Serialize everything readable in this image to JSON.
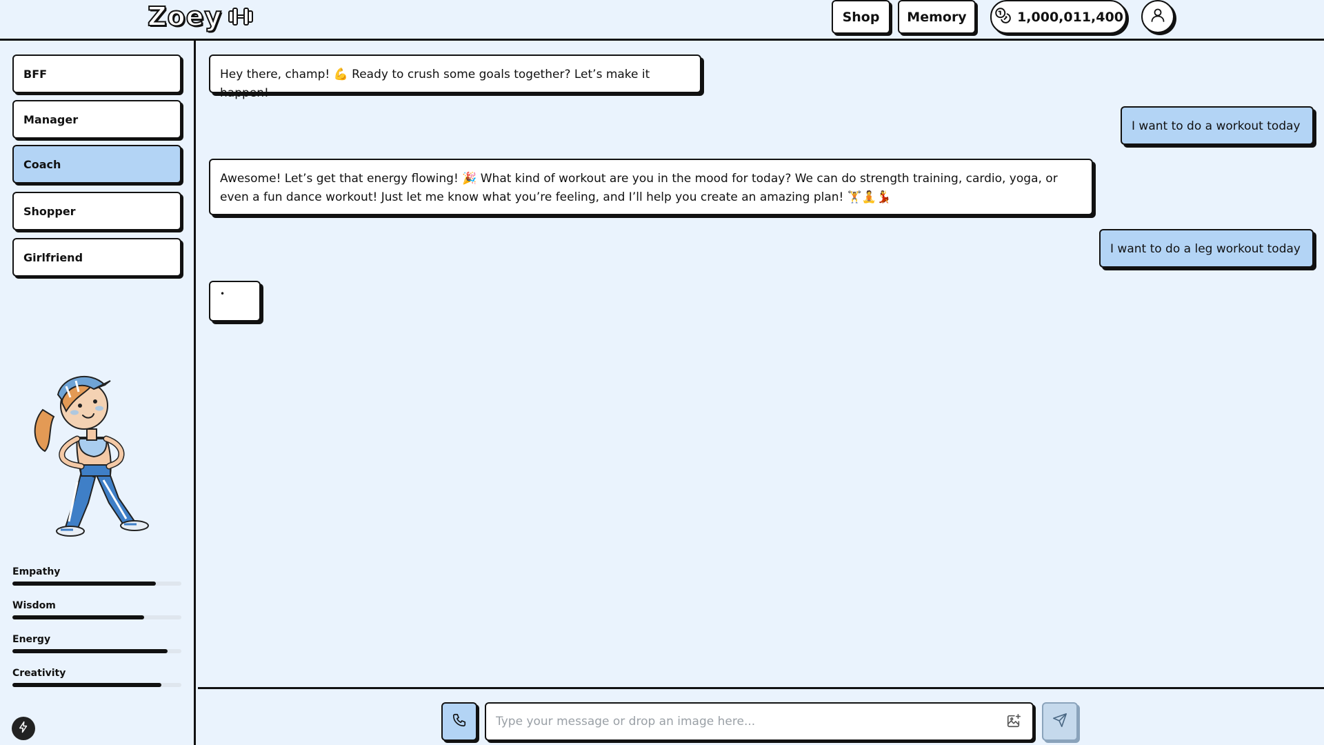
{
  "header": {
    "logo_text": "Zoey",
    "logo_icon": "dumbbell-icon",
    "shop_label": "Shop",
    "memory_label": "Memory",
    "coins": "1,000,011,400",
    "coins_icon": "coins-icon",
    "profile_icon": "user-icon"
  },
  "sidebar": {
    "personas": [
      {
        "label": "BFF",
        "active": false
      },
      {
        "label": "Manager",
        "active": false
      },
      {
        "label": "Coach",
        "active": true
      },
      {
        "label": "Shopper",
        "active": false
      },
      {
        "label": "Girlfriend",
        "active": false
      }
    ],
    "stats": [
      {
        "label": "Empathy",
        "value": 0.85
      },
      {
        "label": "Wisdom",
        "value": 0.78
      },
      {
        "label": "Energy",
        "value": 0.92
      },
      {
        "label": "Creativity",
        "value": 0.88
      }
    ],
    "bolt_icon": "lightning-icon"
  },
  "chat": {
    "messages": [
      {
        "role": "assistant",
        "text": "Hey there, champ! 💪 Ready to crush some goals together? Let’s make it happen!"
      },
      {
        "role": "user",
        "text": "I want to do a workout today"
      },
      {
        "role": "assistant",
        "text": "Awesome! Let’s get that energy flowing! 🎉 What kind of workout are you in the mood for today? We can do strength training, cardio, yoga, or even a fun dance workout! Just let me know what you’re feeling, and I’ll help you create an amazing plan! 🏋️🧘💃"
      },
      {
        "role": "user",
        "text": "I want to do a leg workout today"
      },
      {
        "role": "assistant",
        "text": "•"
      }
    ]
  },
  "composer": {
    "placeholder": "Type your message or drop an image here...",
    "call_icon": "phone-icon",
    "image_icon": "image-add-icon",
    "send_icon": "send-icon"
  },
  "colors": {
    "background": "#eaf3fd",
    "accent": "#b3d4f5",
    "border": "#111111"
  }
}
